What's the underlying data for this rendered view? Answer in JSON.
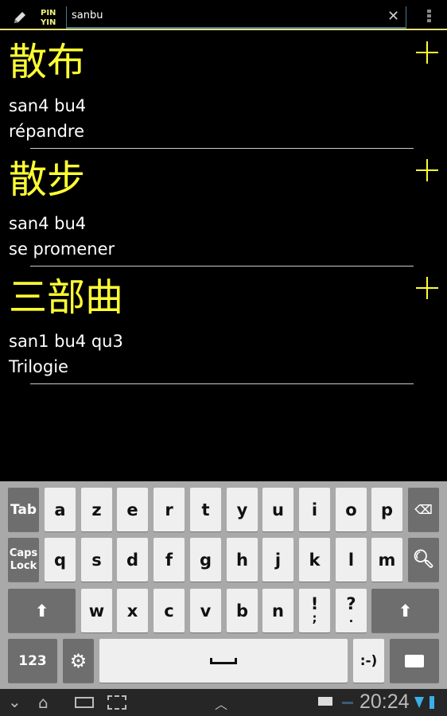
{
  "topbar": {
    "mode_label_line1": "PIN",
    "mode_label_line2": "YIN",
    "search_value": "sanbu",
    "clear_icon": "close-icon",
    "menu_icon": "overflow-menu-icon",
    "edit_icon": "pencil-icon"
  },
  "results": [
    {
      "hanzi": "散布",
      "pinyin": "san4 bu4",
      "meaning": "répandre"
    },
    {
      "hanzi": "散步",
      "pinyin": "san4 bu4",
      "meaning": "se promener"
    },
    {
      "hanzi": "三部曲",
      "pinyin": "san1 bu4 qu3",
      "meaning": "Trilogie"
    }
  ],
  "keyboard": {
    "tab": "Tab",
    "caps1": "Caps",
    "caps2": "Lock",
    "num": "123",
    "smiley": ":-)",
    "row1": [
      "a",
      "z",
      "e",
      "r",
      "t",
      "y",
      "u",
      "i",
      "o",
      "p"
    ],
    "row2": [
      "q",
      "s",
      "d",
      "f",
      "g",
      "h",
      "j",
      "k",
      "l",
      "m"
    ],
    "row3": [
      "w",
      "x",
      "c",
      "v",
      "b",
      "n",
      "!",
      "?"
    ],
    "row3_sub": [
      "",
      "",
      " ",
      "",
      "",
      "",
      ";",
      "."
    ]
  },
  "statusbar": {
    "time": "20:24"
  },
  "colors": {
    "accent": "#ffff33",
    "background": "#000000",
    "keyboard": "#a9a9a9"
  }
}
